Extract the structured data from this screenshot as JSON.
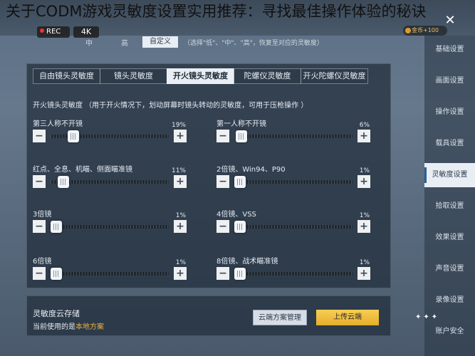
{
  "headline": "关于CODM游戏灵敏度设置实用推荐：寻找最佳操作体验的秘诀",
  "recorder": {
    "rec_label": "REC",
    "resolution_label": "4K"
  },
  "quality": {
    "options": [
      {
        "label": "中"
      },
      {
        "label": "高"
      },
      {
        "label": "自定义",
        "selected": true
      }
    ],
    "hint": "（选择\"低\"、\"中\"、\"高\"，恢复至对应的灵敏度）"
  },
  "currency": {
    "label": "金币+100"
  },
  "sidebar": {
    "items": [
      {
        "label": "基础设置"
      },
      {
        "label": "画面设置"
      },
      {
        "label": "操作设置"
      },
      {
        "label": "载具设置"
      },
      {
        "label": "灵敏度设置",
        "active": true
      },
      {
        "label": "拾取设置"
      },
      {
        "label": "效果设置"
      },
      {
        "label": "声音设置"
      },
      {
        "label": "录像设置"
      },
      {
        "label": "账户安全"
      }
    ]
  },
  "tabs": [
    {
      "label": "自由镜头灵敏度"
    },
    {
      "label": "镜头灵敏度"
    },
    {
      "label": "开火镜头灵敏度",
      "active": true
    },
    {
      "label": "陀螺仪灵敏度"
    },
    {
      "label": "开火陀螺仪灵敏度"
    }
  ],
  "section_desc": "开火镜头灵敏度 （用于开火情况下，划动屏幕时镜头转动的灵敏度，可用于压枪操作 ）",
  "sliders": [
    {
      "label": "第三人称不开镜",
      "value": "19%",
      "level": 0.19
    },
    {
      "label": "第一人称不开镜",
      "value": "6%",
      "level": 0.06
    },
    {
      "label": "红点、全息、机瞄、侧面瞄准镜",
      "value": "11%",
      "level": 0.11
    },
    {
      "label": "2倍镜、Win94、P90",
      "value": "1%",
      "level": 0.01
    },
    {
      "label": "3倍镜",
      "value": "1%",
      "level": 0.01
    },
    {
      "label": "4倍镜、VSS",
      "value": "1%",
      "level": 0.01
    },
    {
      "label": "6倍镜",
      "value": "1%",
      "level": 0.01
    },
    {
      "label": "8倍镜、战术瞄准镜",
      "value": "1%",
      "level": 0.01
    }
  ],
  "step": {
    "minus": "−",
    "plus": "+"
  },
  "cloud": {
    "title": "灵敏度云存储",
    "current_prefix": "当前使用的是",
    "current_plan": "本地方案",
    "manage_label": "云端方案管理",
    "upload_label": "上传云端"
  },
  "close_glyph": "✕",
  "stars": "✦✦✦"
}
